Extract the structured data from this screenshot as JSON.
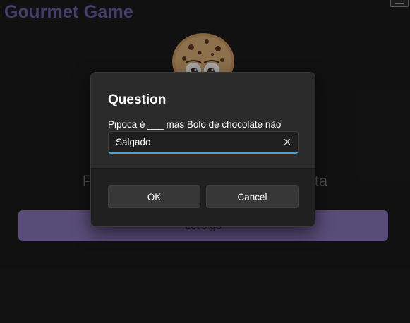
{
  "app": {
    "title": "Gourmet Game",
    "prompt_text": "Pense em um prato que você gosta",
    "start_button_label": "Let's go",
    "accent_color": "#8775b9",
    "title_color": "#6f5fa6"
  },
  "dialog": {
    "title": "Question",
    "label": "Pipoca é ___ mas Bolo de chocolate não",
    "input_value": "Salgado",
    "clear_icon": "×",
    "ok_label": "OK",
    "cancel_label": "Cancel",
    "focus_color": "#4aa3d8"
  },
  "icons": {
    "menu": "menu-icon",
    "cookie": "cookie-icon",
    "clear": "close-icon"
  }
}
